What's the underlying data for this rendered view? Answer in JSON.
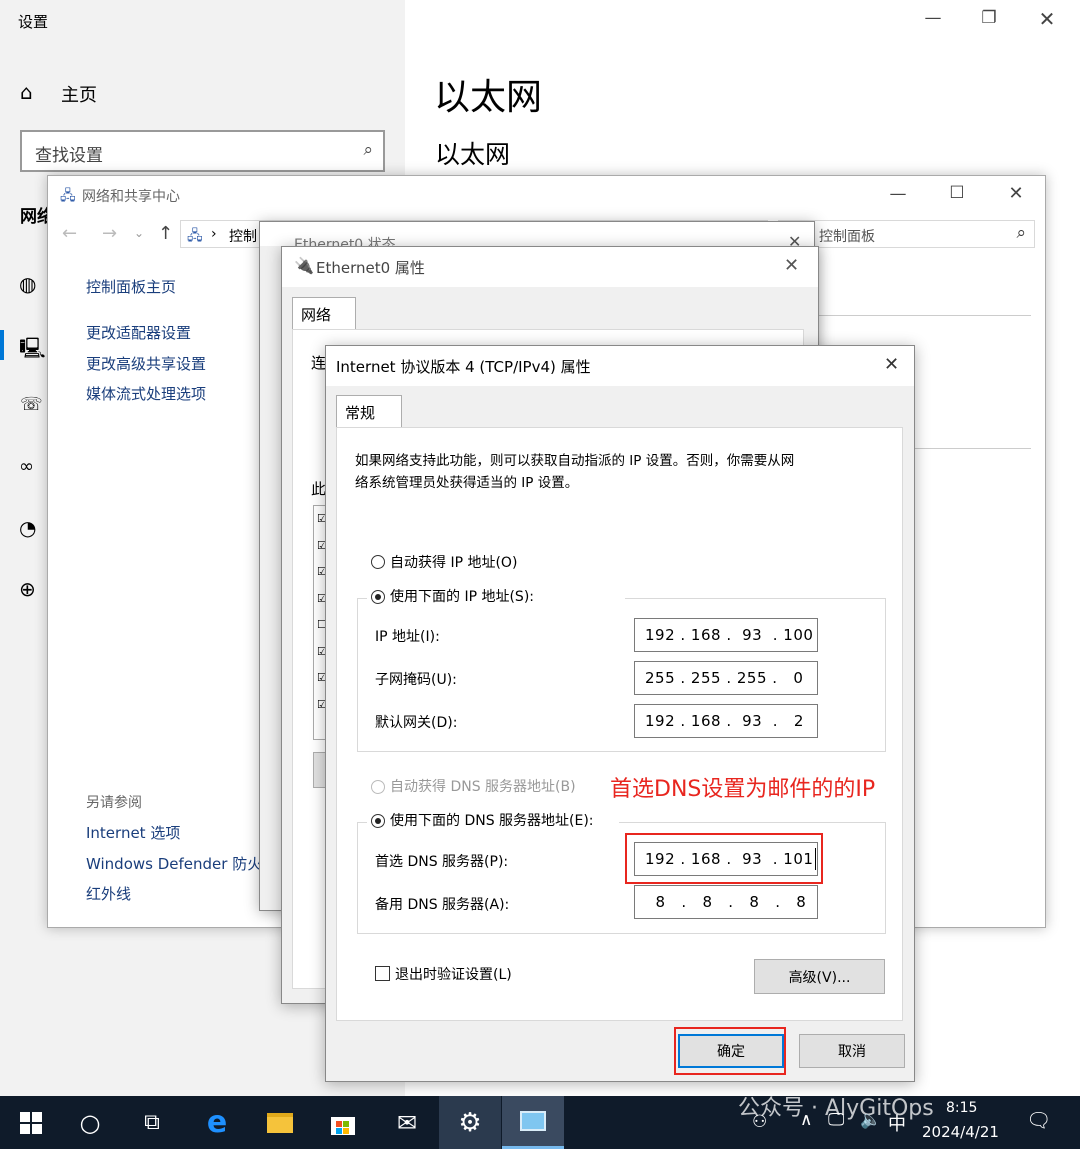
{
  "settings": {
    "app_title": "设置",
    "home_label": "主页",
    "search_placeholder": "查找设置",
    "section_cut": "网络",
    "page_title": "以太网",
    "page_subtitle": "以太网"
  },
  "control_panel": {
    "window_title": "网络和共享中心",
    "breadcrumb": "控制",
    "search_placeholder": "控制面板",
    "sidebar_home": "控制面板主页",
    "links": [
      "更改适配器设置",
      "更改高级共享设置",
      "媒体流式处理选项"
    ],
    "see_also_header": "另请参阅",
    "see_also": [
      "Internet 选项",
      "Windows Defender 防火",
      "红外线"
    ]
  },
  "ethernet_status": {
    "title": "Ethernet0 状态"
  },
  "ethernet_props": {
    "title": "Ethernet0 属性",
    "tab": "网络",
    "conn_label_cut": "连",
    "items_label_cut": "此"
  },
  "tcp": {
    "title": "Internet 协议版本 4 (TCP/IPv4) 属性",
    "tab": "常规",
    "description": [
      "如果网络支持此功能，则可以获取自动指派的 IP 设置。否则，你需要从网",
      "络系统管理员处获得适当的 IP 设置。"
    ],
    "auto_ip": "自动获得 IP 地址(O)",
    "manual_ip": "使用下面的 IP 地址(S):",
    "ip_label": "IP 地址(I):",
    "ip_value": "192 . 168 .  93  . 100",
    "mask_label": "子网掩码(U):",
    "mask_value": "255 . 255 . 255 .   0",
    "gateway_label": "默认网关(D):",
    "gateway_value": "192 . 168 .  93  .   2",
    "auto_dns": "自动获得 DNS 服务器地址(B)",
    "manual_dns": "使用下面的 DNS 服务器地址(E):",
    "preferred_dns_label": "首选 DNS 服务器(P):",
    "preferred_dns_value": "192 . 168 .  93  . 101",
    "alternate_dns_label": "备用 DNS 服务器(A):",
    "alternate_dns_value": "  8   .   8   .   8   .   8",
    "validate_label": "退出时验证设置(L)",
    "advanced_button": "高级(V)...",
    "ok_button": "确定",
    "cancel_button": "取消",
    "annotation": "首选DNS设置为邮件的的IP"
  },
  "taskbar": {
    "time": "8:15",
    "date": "2024/4/21",
    "ime": "中",
    "watermark": "公众号 · AlyGitOps"
  },
  "colors": {
    "highlight_red": "#e8261f",
    "taskbar": "#0f1b2a",
    "accent": "#0078d7"
  }
}
